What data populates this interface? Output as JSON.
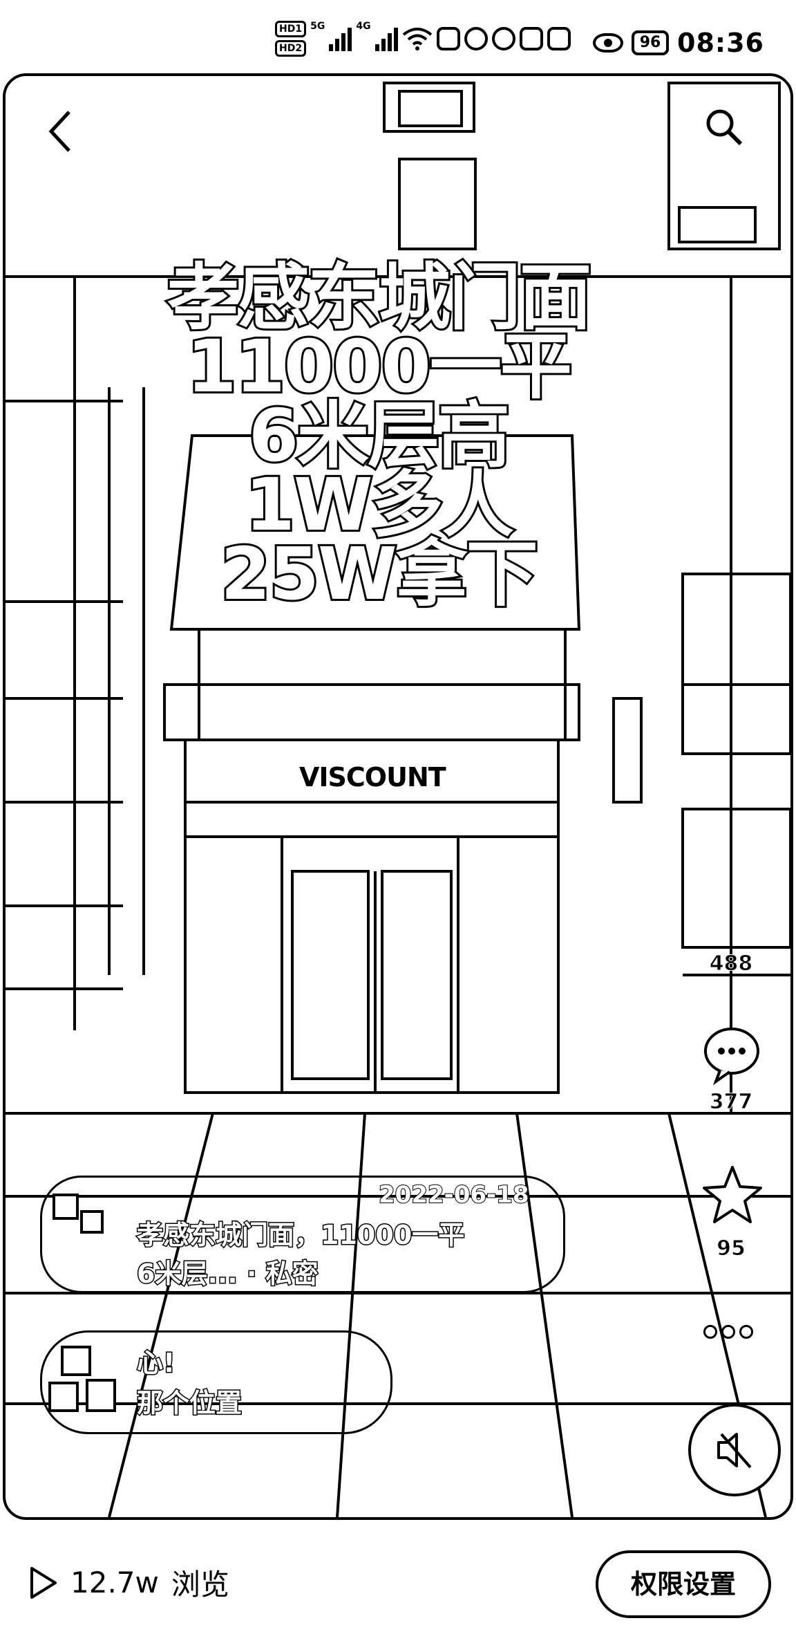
{
  "status_bar": {
    "hd_1": "HD1",
    "hd_2": "HD2",
    "net_1": "5G",
    "net_2": "4G",
    "battery": "96",
    "time": "08:36"
  },
  "video": {
    "back_icon": "chevron-left-icon",
    "search_icon": "search-icon",
    "caption_lines": [
      "孝感东城门面",
      "11000一平",
      "6米层高",
      "1W多人",
      "25W拿下"
    ],
    "storefront_sign": "VISCOUNT",
    "actions": {
      "like_count": "488",
      "comment_count": "377",
      "favorite_count": "95"
    },
    "post": {
      "date": "2022-06-18",
      "text_line_1": "孝感东城门面，11000一平",
      "text_line_2": "6米层...",
      "privacy": "· 私密"
    },
    "comment": {
      "line_1": "心!",
      "line_2": "那个位置"
    }
  },
  "bottom_bar": {
    "views": "12.7w",
    "views_label": "浏览",
    "permissions_button": "权限设置"
  }
}
